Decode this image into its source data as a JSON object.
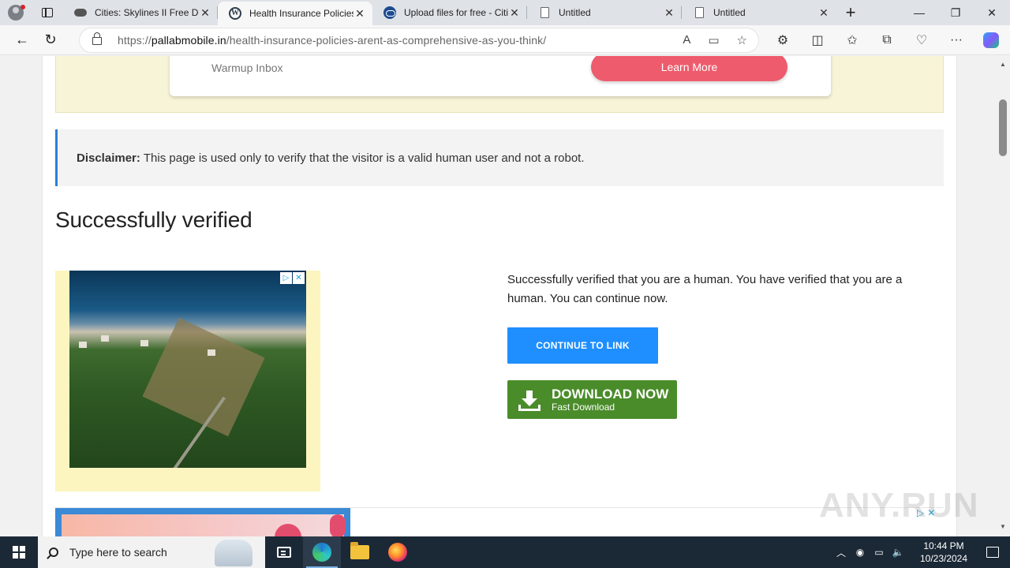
{
  "browser": {
    "tabs": [
      {
        "title": "Cities: Skylines II Free Do",
        "favicon": "gamepad-icon",
        "active": false
      },
      {
        "title": "Health Insurance Policies",
        "favicon": "wordpress-icon",
        "active": true
      },
      {
        "title": "Upload files for free - Citi",
        "favicon": "cloud-icon",
        "active": false
      },
      {
        "title": "Untitled",
        "favicon": "document-icon",
        "active": false
      },
      {
        "title": "Untitled",
        "favicon": "document-icon",
        "active": false
      }
    ],
    "url_scheme": "https://",
    "url_host": "pallabmobile.in",
    "url_path": "/health-insurance-policies-arent-as-comprehensive-as-you-think/"
  },
  "page": {
    "top_ad": {
      "brand": "Warmup Inbox",
      "cta": "Learn More"
    },
    "disclaimer": {
      "label": "Disclaimer:",
      "text": "This page is used only to verify that the visitor is a valid human user and not a robot."
    },
    "heading": "Successfully verified",
    "message": "Successfully verified that you are a human. You have verified that you are a human. You can continue now.",
    "continue_button": "CONTINUE TO LINK",
    "download_button": {
      "main": "DOWNLOAD NOW",
      "sub": "Fast Download"
    },
    "watermark": "ANY.RUN"
  },
  "taskbar": {
    "search_placeholder": "Type here to search",
    "time": "10:44 PM",
    "date": "10/23/2024"
  },
  "colors": {
    "continue_blue": "#1f8fff",
    "download_green": "#4a8c2a",
    "learn_more_pink": "#ee5b6c",
    "disclaimer_accent": "#2b7fd8"
  }
}
